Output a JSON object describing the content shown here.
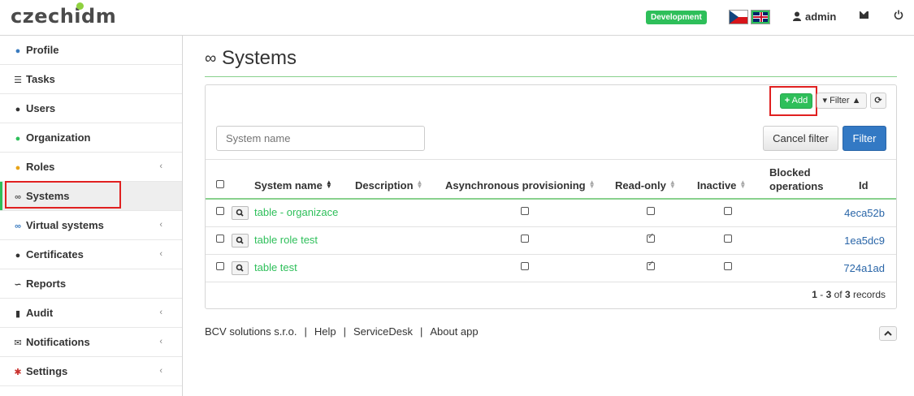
{
  "brand": {
    "part1": "czech",
    "part2": "idm"
  },
  "header": {
    "environment_badge": "Development",
    "languages": [
      "cs",
      "en"
    ],
    "username": "admin",
    "icons": [
      "user-icon",
      "envelope-icon",
      "power-icon"
    ]
  },
  "sidebar": {
    "items": [
      {
        "label": "Profile",
        "icon": "user-icon",
        "has_submenu": false,
        "active": false
      },
      {
        "label": "Tasks",
        "icon": "tasks-icon",
        "has_submenu": false,
        "active": false
      },
      {
        "label": "Users",
        "icon": "users-icon",
        "has_submenu": false,
        "active": false
      },
      {
        "label": "Organization",
        "icon": "tree-icon",
        "has_submenu": false,
        "active": false
      },
      {
        "label": "Roles",
        "icon": "role-icon",
        "has_submenu": true,
        "active": false
      },
      {
        "label": "Systems",
        "icon": "link-icon",
        "has_submenu": false,
        "active": true
      },
      {
        "label": "Virtual systems",
        "icon": "link-icon",
        "has_submenu": true,
        "active": false
      },
      {
        "label": "Certificates",
        "icon": "certificate-icon",
        "has_submenu": true,
        "active": false
      },
      {
        "label": "Reports",
        "icon": "chart-icon",
        "has_submenu": false,
        "active": false
      },
      {
        "label": "Audit",
        "icon": "bar-chart-icon",
        "has_submenu": true,
        "active": false
      },
      {
        "label": "Notifications",
        "icon": "envelope-icon",
        "has_submenu": true,
        "active": false
      },
      {
        "label": "Settings",
        "icon": "cog-icon",
        "has_submenu": true,
        "active": false
      }
    ],
    "caret": "‹"
  },
  "page": {
    "title": "Systems"
  },
  "toolbar": {
    "add_label": "Add",
    "add_prefix": "+",
    "filter_label": "Filter",
    "refresh_label": "⟳"
  },
  "filter": {
    "system_name_placeholder": "System name",
    "cancel_label": "Cancel filter",
    "apply_label": "Filter"
  },
  "table": {
    "columns": {
      "system_name": "System name",
      "description": "Description",
      "async": "Asynchronous provisioning",
      "readonly": "Read-only",
      "inactive": "Inactive",
      "blocked_line1": "Blocked",
      "blocked_line2": "operations",
      "id": "Id"
    },
    "rows": [
      {
        "name": "table - organizace",
        "description": "",
        "async": false,
        "readonly": false,
        "inactive": false,
        "id": "4eca52b"
      },
      {
        "name": "table role test",
        "description": "",
        "async": false,
        "readonly": true,
        "inactive": false,
        "id": "1ea5dc9"
      },
      {
        "name": "table test",
        "description": "",
        "async": false,
        "readonly": true,
        "inactive": false,
        "id": "724a1ad"
      }
    ],
    "pagination": {
      "from": "1",
      "dash": " - ",
      "to": "3",
      "of": " of ",
      "total": "3",
      "suffix": " records"
    }
  },
  "footer": {
    "company": "BCV solutions s.r.o.",
    "help": "Help",
    "servicedesk": "ServiceDesk",
    "about": "About app",
    "separator": "|"
  },
  "colors": {
    "brand_green": "#2ebf5a",
    "primary_blue": "#3379c4",
    "highlight_red": "#e02020"
  }
}
